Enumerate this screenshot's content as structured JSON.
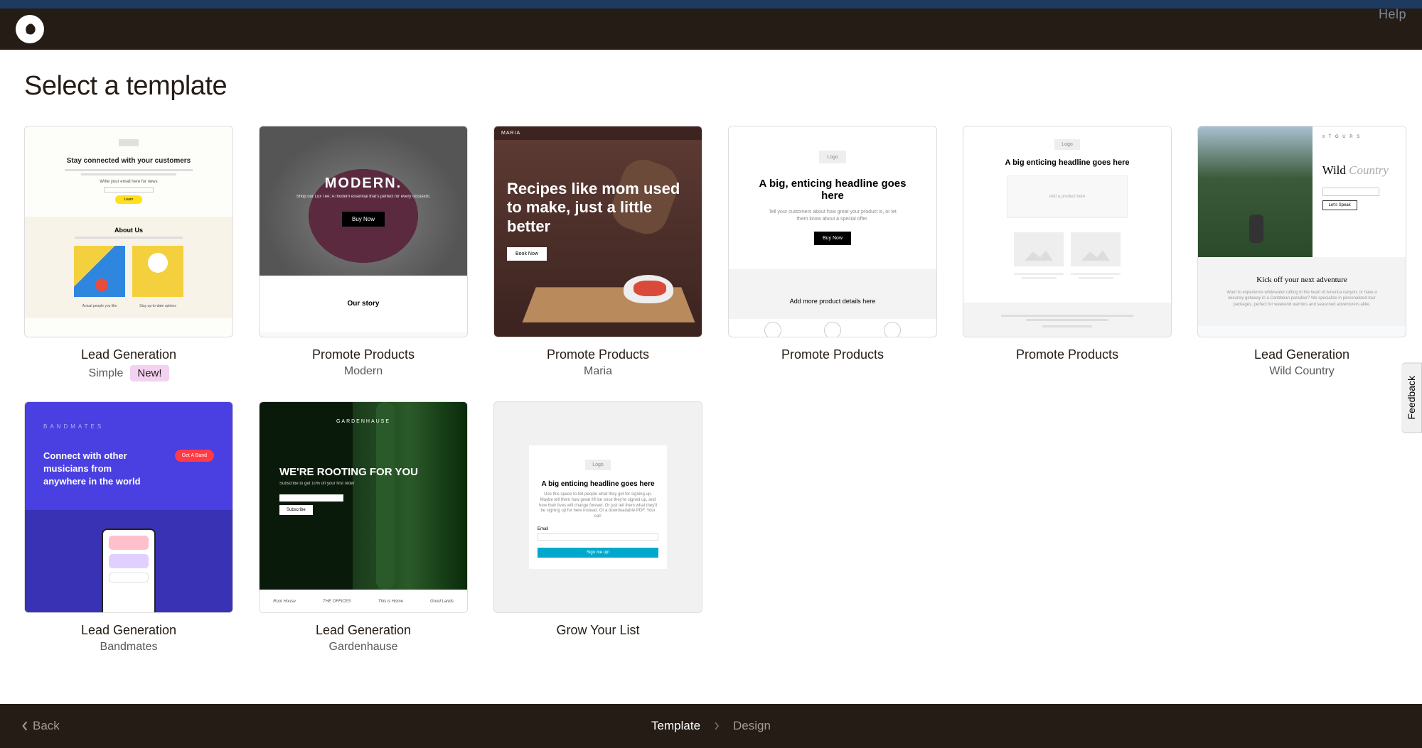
{
  "header": {
    "help": "Help"
  },
  "page": {
    "title": "Select a template"
  },
  "templates": [
    {
      "category": "Lead Generation",
      "subtitle": "Simple",
      "badge": "New!"
    },
    {
      "category": "Promote Products",
      "subtitle": "Modern"
    },
    {
      "category": "Promote Products",
      "subtitle": "Maria"
    },
    {
      "category": "Promote Products",
      "subtitle": ""
    },
    {
      "category": "Promote Products",
      "subtitle": ""
    },
    {
      "category": "Lead Generation",
      "subtitle": "Wild Country"
    },
    {
      "category": "Lead Generation",
      "subtitle": "Bandmates"
    },
    {
      "category": "Lead Generation",
      "subtitle": "Gardenhause"
    },
    {
      "category": "Grow Your List",
      "subtitle": ""
    }
  ],
  "thumbnails": {
    "t1": {
      "headline": "Stay connected with your customers",
      "about": "About Us",
      "cap1": "Actual people you like",
      "cap2": "Stay up-to-date options"
    },
    "t2": {
      "brand": "MODERN.",
      "tagline": "Shop our Lux Tee: A modern essential that's perfect for every occasion.",
      "buy": "Buy Now",
      "story": "Our story"
    },
    "t3": {
      "brand": "MARIA",
      "headline": "Recipes like mom used to make, just a little better",
      "book": "Book Now"
    },
    "t4": {
      "logo": "Logo",
      "headline": "A big, enticing headline goes here",
      "desc": "Tell your customers about how great your product is, or let them know about a special offer.",
      "buy": "Buy Now",
      "more": "Add more product details here"
    },
    "t5": {
      "logo": "Logo",
      "headline": "A big enticing headline goes here",
      "box": "Add a product here"
    },
    "t6": {
      "nav": "≡  T O U R S",
      "title1": "Wild",
      "title2": "Country",
      "btn": "Let's Speak",
      "kick": "Kick off your next adventure",
      "desc": "Want to experience whitewater rafting in the heart of America canyon, or have a leisurely getaway in a Caribbean paradise? We specialize in personalized tour packages, perfect for weekend warriors and seasoned adventurers alike."
    },
    "t7": {
      "brand": "BANDMATES",
      "txt": "Connect with other musicians from anywhere in the world",
      "pill": "Get A Band"
    },
    "t8": {
      "brand": "GARDENHAUSE",
      "headline": "WE'RE ROOTING FOR YOU",
      "sub": "Subscribe to get 10% off your first order",
      "btn": "Subscribe",
      "logos": [
        "Root House",
        "THE OFFICES",
        "This is Home",
        "Good Lands"
      ]
    },
    "t9": {
      "logo": "Logo",
      "headline": "A big enticing headline goes here",
      "desc": "Use this space to tell people what they get for signing up. Maybe tell them how great it'll be once they're signed up, and how their lives will change forever. Or just tell them what they'll be signing up for here instead. Or a downloadable PDF. Your call.",
      "label": "Email",
      "signup": "Sign me up!"
    }
  },
  "feedback": "Feedback",
  "footer": {
    "back": "Back",
    "step1": "Template",
    "step2": "Design"
  }
}
